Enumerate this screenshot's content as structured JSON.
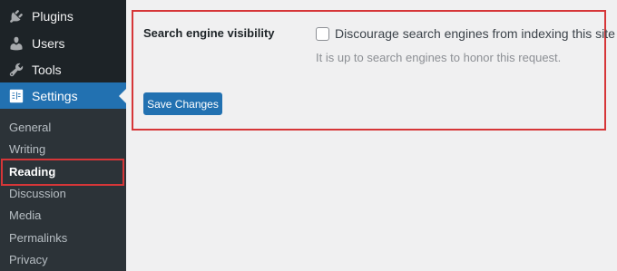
{
  "sidebar": {
    "menu": [
      {
        "label": "Plugins",
        "icon": "plugin-icon"
      },
      {
        "label": "Users",
        "icon": "users-icon"
      },
      {
        "label": "Tools",
        "icon": "wrench-icon"
      },
      {
        "label": "Settings",
        "icon": "settings-icon",
        "current": true
      }
    ],
    "submenu": [
      {
        "label": "General"
      },
      {
        "label": "Writing"
      },
      {
        "label": "Reading",
        "active": true
      },
      {
        "label": "Discussion"
      },
      {
        "label": "Media"
      },
      {
        "label": "Permalinks"
      },
      {
        "label": "Privacy"
      }
    ]
  },
  "form": {
    "field_label": "Search engine visibility",
    "checkbox_label": "Discourage search engines from indexing this site",
    "checkbox_checked": false,
    "description": "It is up to search engines to honor this request.",
    "save_label": "Save Changes"
  },
  "colors": {
    "sidebar_bg": "#1d2327",
    "submenu_bg": "#2c3338",
    "accent": "#2271b1",
    "highlight_border": "#d63638",
    "page_bg": "#f0f0f1"
  }
}
